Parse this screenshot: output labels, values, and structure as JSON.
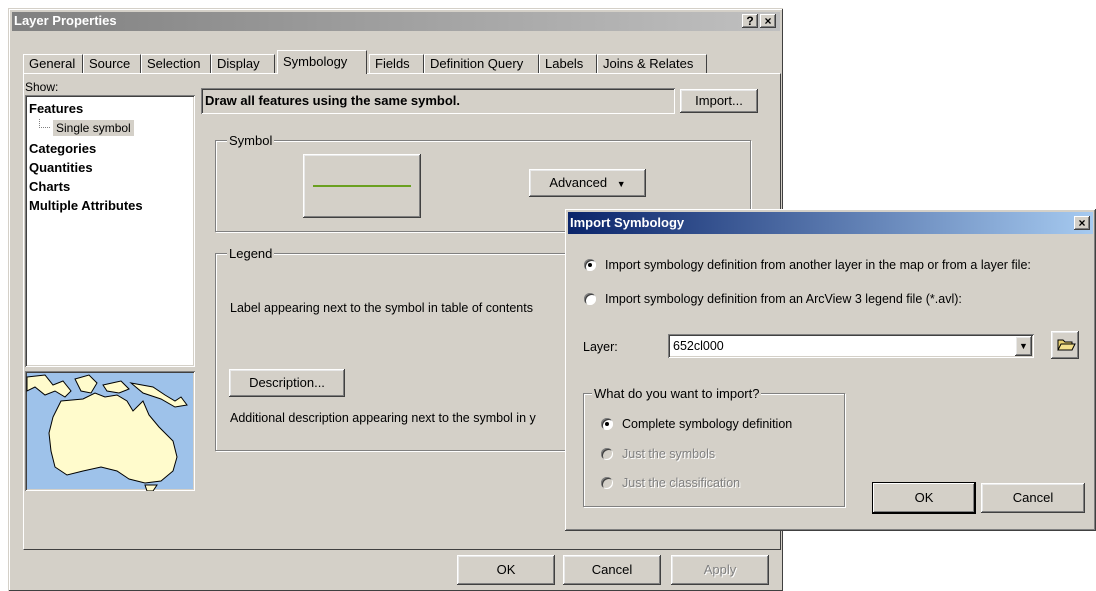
{
  "main_window": {
    "title": "Layer Properties",
    "help_btn": "?",
    "close_btn": "×",
    "tabs": [
      "General",
      "Source",
      "Selection",
      "Display",
      "Symbology",
      "Fields",
      "Definition Query",
      "Labels",
      "Joins & Relates"
    ],
    "active_tab": "Symbology",
    "show_label": "Show:",
    "show_list": {
      "features": "Features",
      "single_symbol": "Single symbol",
      "categories": "Categories",
      "quantities": "Quantities",
      "charts": "Charts",
      "multiple_attributes": "Multiple Attributes"
    },
    "heading": "Draw all features using the same symbol.",
    "import_btn": "Import...",
    "symbol_group": "Symbol",
    "advanced_btn": "Advanced",
    "legend_group": "Legend",
    "label_text": "Label appearing next to the symbol in table of contents",
    "description_btn": "Description...",
    "desc_text": "Additional description appearing next to the symbol in y",
    "ok": "OK",
    "cancel": "Cancel",
    "apply": "Apply"
  },
  "dialog": {
    "title": "Import Symbology",
    "close_btn": "×",
    "option1": "Import symbology definition from another layer in the map or from a layer file:",
    "option2": "Import symbology definition from an ArcView 3 legend file (*.avl):",
    "layer_label": "Layer:",
    "layer_value": "652cl000",
    "what_group": "What do you want to import?",
    "opt_complete": "Complete symbology definition",
    "opt_symbols": "Just the symbols",
    "opt_classification": "Just the classification",
    "ok": "OK",
    "cancel": "Cancel"
  },
  "colors": {
    "title_active": "#0a246a",
    "title_inactive": "#808080",
    "symbol_line": "#6aa020",
    "map_water": "#9ec2ea",
    "map_land": "#fffbcc"
  }
}
